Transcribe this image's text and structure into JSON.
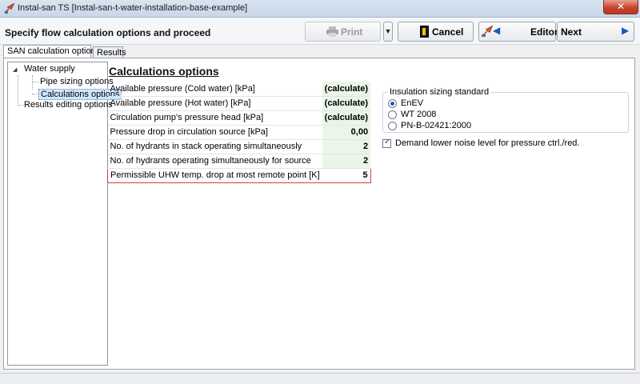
{
  "window": {
    "title": "Instal-san TS [Instal-san-t-water-installation-base-example]",
    "close_label": "✕"
  },
  "header": {
    "heading": "Specify flow calculation options and proceed",
    "print_label": "Print",
    "cancel_label": "Cancel",
    "editor_label": "Editor",
    "next_label": "Next"
  },
  "tabs": [
    {
      "label": "SAN calculation options",
      "active": true
    },
    {
      "label": "Results",
      "active": false
    }
  ],
  "tree": {
    "items": [
      {
        "label": "Water supply"
      },
      {
        "label": "Pipe sizing options"
      },
      {
        "label": "Calculations options",
        "selected": true
      },
      {
        "label": "Results editing options"
      }
    ]
  },
  "content": {
    "title": "Calculations options",
    "rows": [
      {
        "label": "Available pressure (Cold water) [kPa]",
        "value": "(calculate)"
      },
      {
        "label": "Available pressure (Hot water) [kPa]",
        "value": "(calculate)"
      },
      {
        "label": "Circulation pump's pressure head [kPa]",
        "value": "(calculate)"
      },
      {
        "label": "Pressure drop in circulation source [kPa]",
        "value": "0,00"
      },
      {
        "label": "No. of hydrants in stack operating simultaneously",
        "value": "2"
      },
      {
        "label": "No. of hydrants operating simultaneously for source",
        "value": "2"
      },
      {
        "label": "Permissible UHW temp. drop at most remote point [K]",
        "value": "5"
      }
    ],
    "insulation": {
      "legend": "Insulation sizing standard",
      "options": [
        {
          "label": "EnEV",
          "checked": true
        },
        {
          "label": "WT 2008",
          "checked": false
        },
        {
          "label": "PN-B-02421:2000",
          "checked": false
        }
      ]
    },
    "checkbox": {
      "label": "Demand lower noise level for pressure ctrl./red.",
      "checked": true
    }
  },
  "colors": {
    "title_bar": "#c7d6e9",
    "close_button": "#c7432b",
    "accent_blue": "#1b55c9",
    "value_cell_bg": "#eaf6e8",
    "selected_row_border": "#d3403e"
  }
}
